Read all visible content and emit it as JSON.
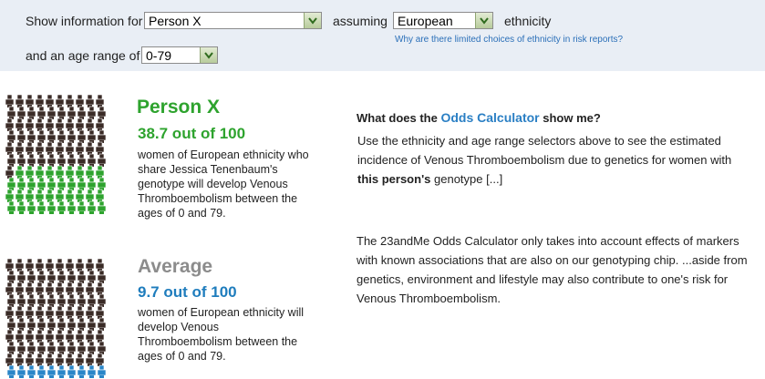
{
  "filters": {
    "show_label": "Show information for",
    "person_value": "Person X",
    "assuming_label": "assuming",
    "ethnicity_value": "European",
    "ethnicity_label": "ethnicity",
    "why_link": "Why are there limited choices of ethnicity in risk reports?",
    "age_label": "and an age range of",
    "age_value": "0-79"
  },
  "person": {
    "name": "Person X",
    "odds": "38.7 out of 100",
    "description": "women of European ethnicity who share Jessica Tenenbaum's genotype will develop Venous Thromboembolism between the ages of 0 and 79.",
    "figure_fraction": 0.387
  },
  "average": {
    "name": "Average",
    "odds": "9.7 out of 100",
    "description": "women of European ethnicity will develop Venous Thromboembolism between the ages of 0 and 79.",
    "figure_fraction": 0.097
  },
  "info": {
    "question_pre": "What does the",
    "question_brand": "Odds Calculator",
    "question_post": "show me?",
    "para1_a": "Use the ethnicity and age range selectors above to see the estimated incidence of Venous Thromboembolism due to genetics for women with",
    "para1_b": "this person's",
    "para1_c": "genotype",
    "para1_more": "[...]",
    "para2": "The 23andMe Odds Calculator only takes into account effects of markers with known associations that are also on our genotyping chip. ...aside from genetics, environment and lifestyle may also contribute to one's risk for Venous Thromboembolism."
  },
  "colors": {
    "person_title": "#2ea32e",
    "person_fill": "#2ea32e",
    "average_title": "#8c8c8c",
    "average_fill": "#2a86c8",
    "odds_blue": "#1f7dbd",
    "dark_fill": "#3a2b26",
    "topbar": "#e9eef5"
  }
}
